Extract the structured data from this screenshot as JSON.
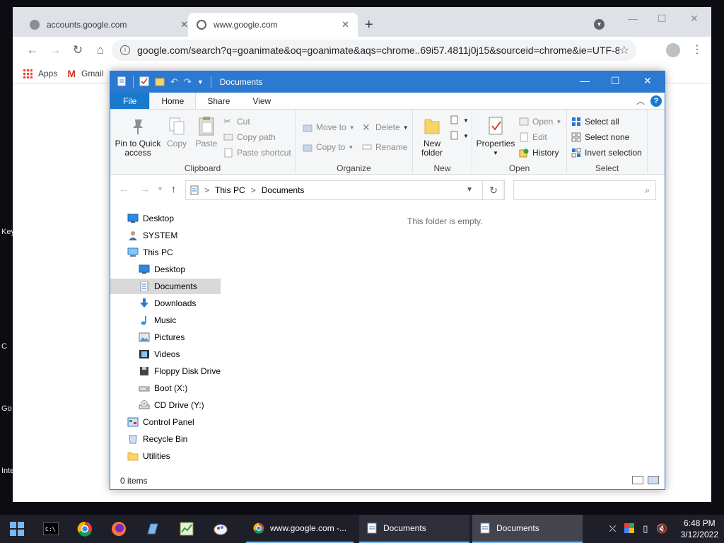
{
  "desktop_labels": [
    "Key",
    "C",
    "Go",
    "Inte"
  ],
  "chrome": {
    "tabs": [
      {
        "label": "accounts.google.com",
        "close": "✕"
      },
      {
        "label": "www.google.com",
        "close": "✕"
      }
    ],
    "new_tab": "+",
    "window_controls": [
      "—",
      "☐",
      "✕"
    ],
    "url": "google.com/search?q=goanimate&oq=goanimate&aqs=chrome..69i57.4811j0j15&sourceid=chrome&ie=UTF-8",
    "bookmarks": [
      {
        "label": "Apps"
      },
      {
        "label": "Gmail"
      }
    ]
  },
  "explorer": {
    "title": "Documents",
    "ribbon_tabs": [
      "File",
      "Home",
      "Share",
      "View"
    ],
    "help": "?",
    "groups": {
      "clipboard": {
        "label": "Clipboard",
        "pin": "Pin to Quick access",
        "copy": "Copy",
        "paste": "Paste",
        "cut": "Cut",
        "copy_path": "Copy path",
        "paste_shortcut": "Paste shortcut"
      },
      "organize": {
        "label": "Organize",
        "move_to": "Move to",
        "copy_to": "Copy to",
        "delete": "Delete",
        "rename": "Rename"
      },
      "new": {
        "label": "New",
        "new_folder": "New folder"
      },
      "open": {
        "label": "Open",
        "properties": "Properties",
        "open": "Open",
        "edit": "Edit",
        "history": "History"
      },
      "select": {
        "label": "Select",
        "select_all": "Select all",
        "select_none": "Select none",
        "invert": "Invert selection"
      }
    },
    "address": {
      "crumbs": [
        "This PC",
        "Documents"
      ],
      "separator": ">"
    },
    "nav_items": [
      {
        "label": "Desktop",
        "indent": 0,
        "icon": "desktop-icon"
      },
      {
        "label": "SYSTEM",
        "indent": 0,
        "icon": "user-icon"
      },
      {
        "label": "This PC",
        "indent": 0,
        "icon": "computer-icon"
      },
      {
        "label": "Desktop",
        "indent": 1,
        "icon": "desktop-icon"
      },
      {
        "label": "Documents",
        "indent": 1,
        "icon": "documents-icon",
        "selected": true
      },
      {
        "label": "Downloads",
        "indent": 1,
        "icon": "downloads-icon"
      },
      {
        "label": "Music",
        "indent": 1,
        "icon": "music-icon"
      },
      {
        "label": "Pictures",
        "indent": 1,
        "icon": "pictures-icon"
      },
      {
        "label": "Videos",
        "indent": 1,
        "icon": "videos-icon"
      },
      {
        "label": "Floppy Disk Drive",
        "indent": 1,
        "icon": "floppy-icon"
      },
      {
        "label": "Boot (X:)",
        "indent": 1,
        "icon": "drive-icon"
      },
      {
        "label": "CD Drive (Y:)",
        "indent": 1,
        "icon": "cd-icon"
      },
      {
        "label": "Control Panel",
        "indent": 0,
        "icon": "control-panel-icon"
      },
      {
        "label": "Recycle Bin",
        "indent": 0,
        "icon": "recycle-bin-icon"
      },
      {
        "label": "Utilities",
        "indent": 0,
        "icon": "folder-icon"
      }
    ],
    "empty_message": "This folder is empty.",
    "status": "0 items"
  },
  "taskbar": {
    "tasks": [
      {
        "label": "www.google.com -..."
      },
      {
        "label": "Documents"
      },
      {
        "label": "Documents"
      }
    ],
    "time": "6:48 PM",
    "date": "3/12/2022"
  },
  "colors": {
    "explorer_accent": "#2b79d0",
    "file_tab": "#1979ca",
    "taskbar": "#1f1f2a"
  }
}
